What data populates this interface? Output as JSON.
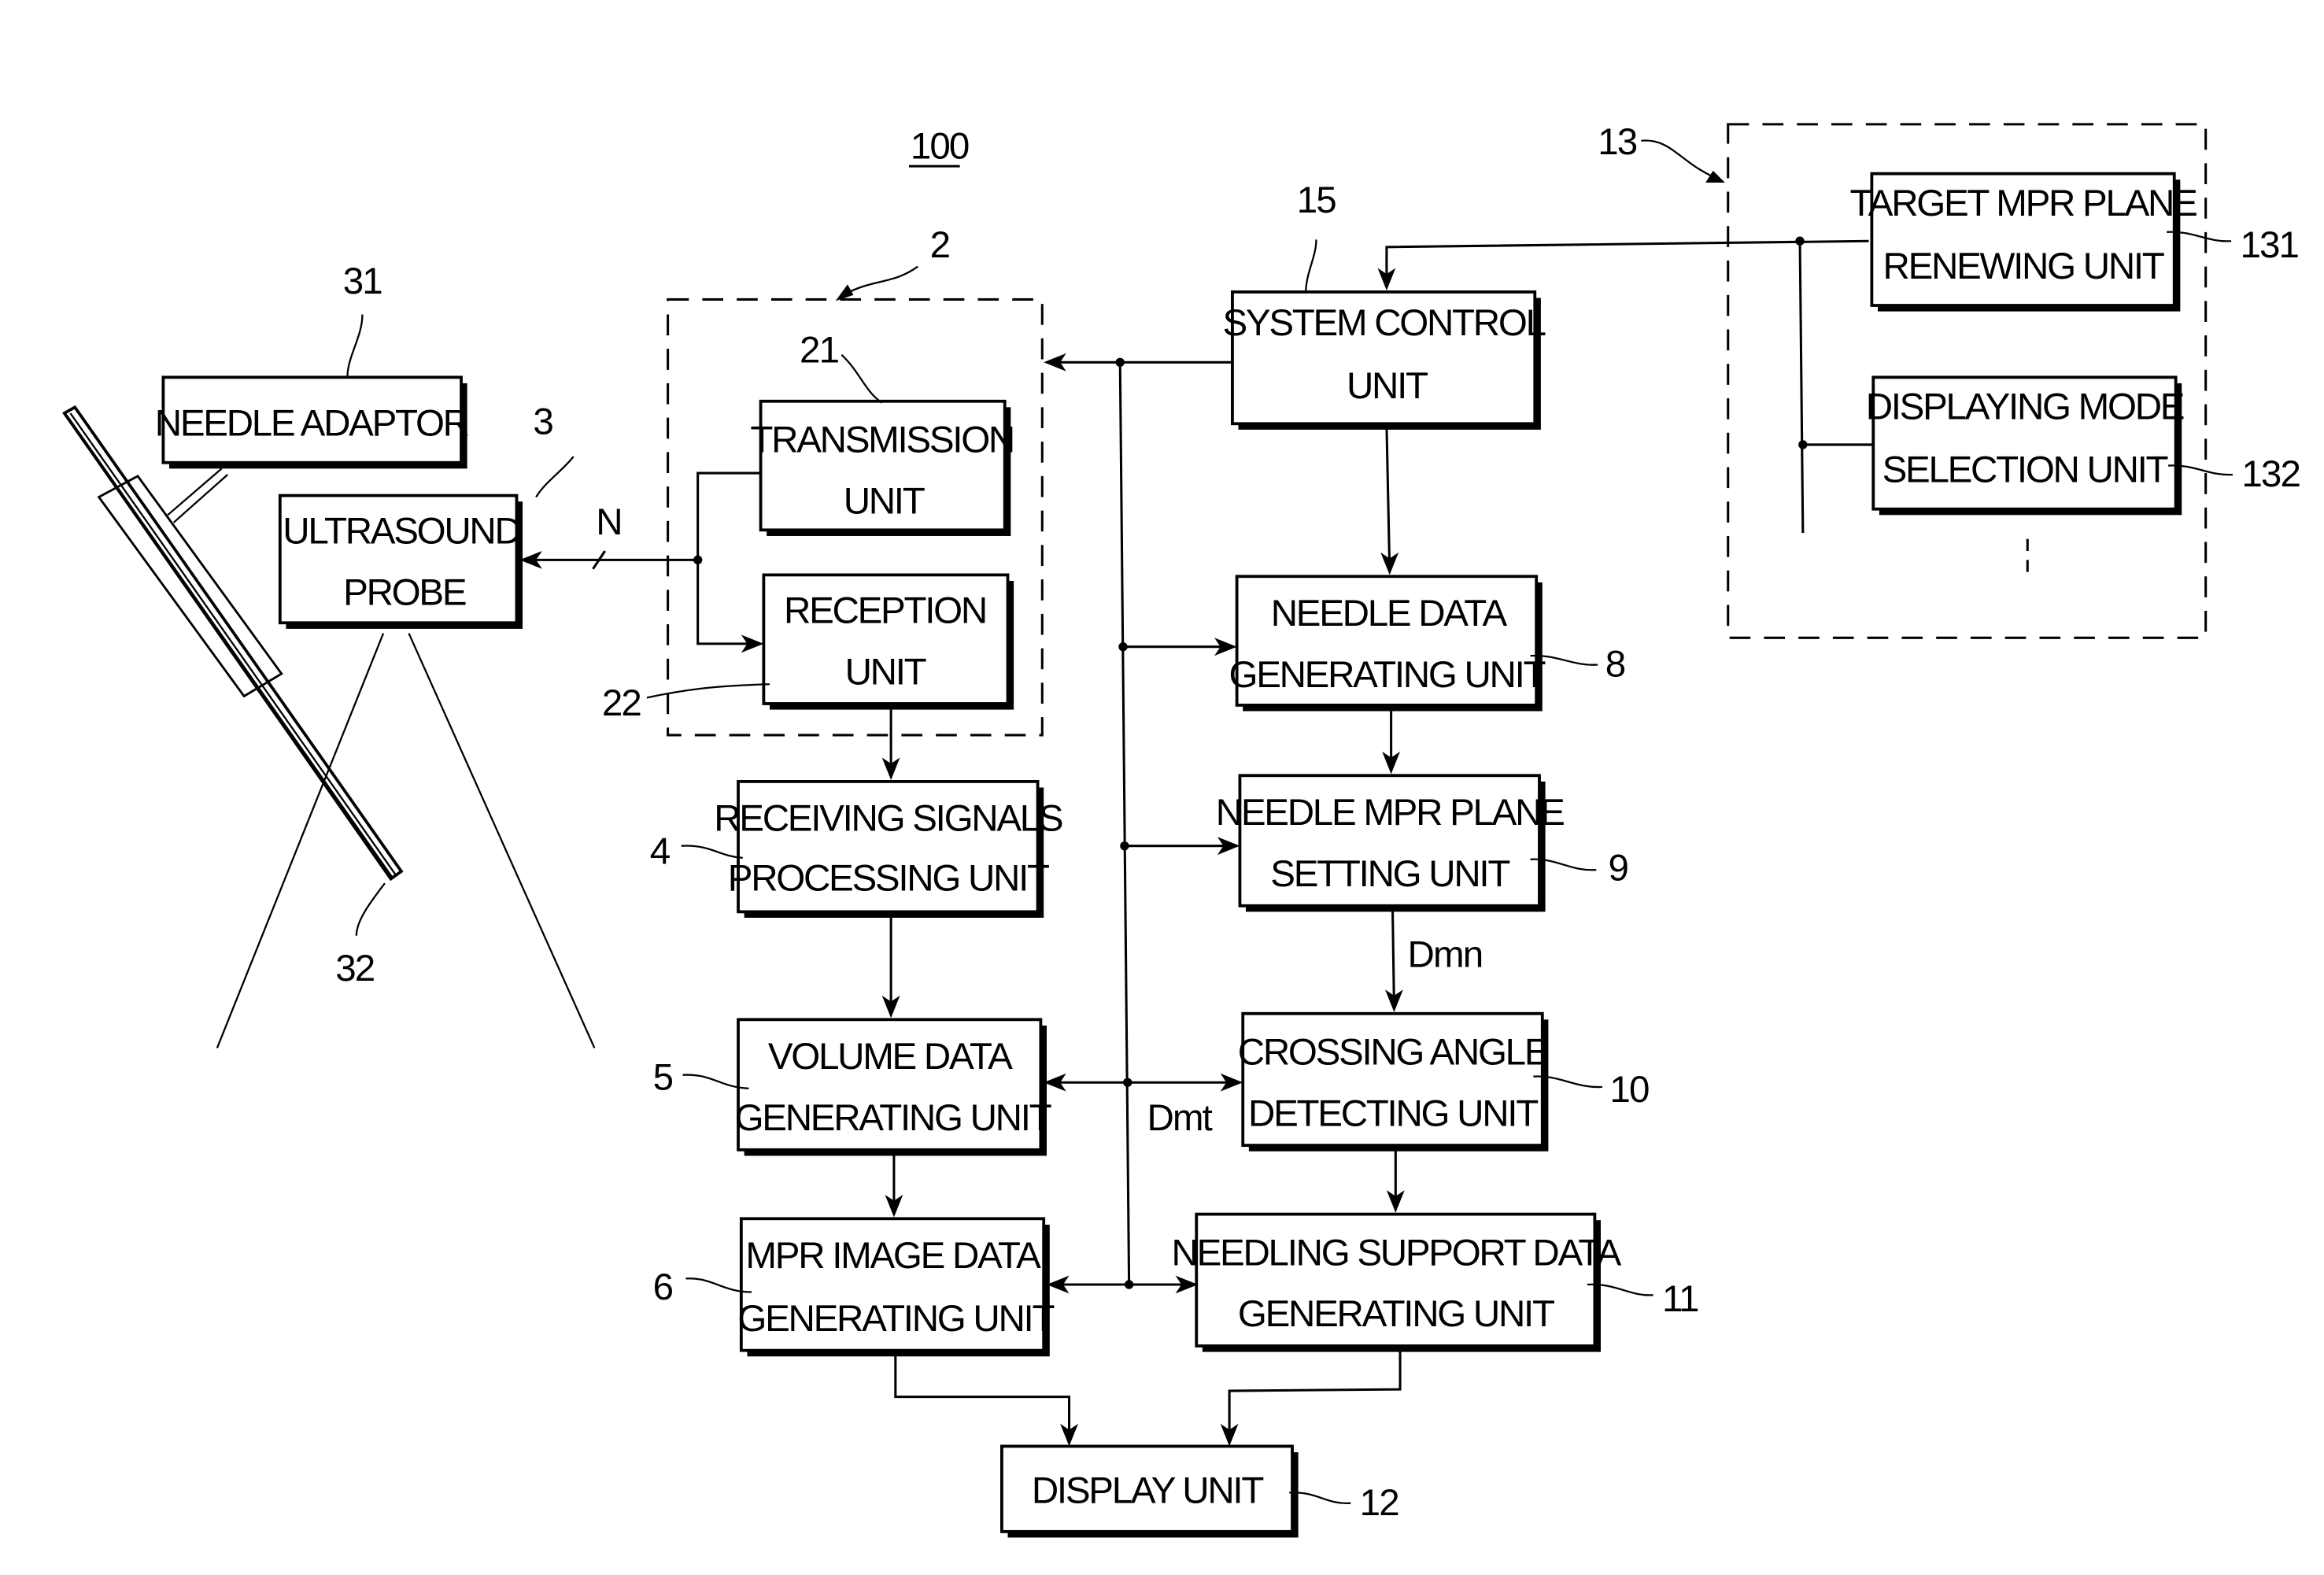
{
  "figure": {
    "reference": "100"
  },
  "blocks": {
    "needle_adaptor": {
      "ref": "31",
      "lines": [
        "NEEDLE ADAPTOR"
      ]
    },
    "ultrasound_probe": {
      "ref": "3",
      "lines": [
        "ULTRASOUND",
        "PROBE"
      ]
    },
    "transmission_unit": {
      "ref": "21",
      "lines": [
        "TRANSMISSION",
        "UNIT"
      ]
    },
    "reception_unit": {
      "ref": "22",
      "lines": [
        "RECEPTION",
        "UNIT"
      ]
    },
    "transceiver_group": {
      "ref": "2"
    },
    "system_control_unit": {
      "ref": "15",
      "lines": [
        "SYSTEM CONTROL",
        "UNIT"
      ]
    },
    "input_group": {
      "ref": "13"
    },
    "target_mpr_plane_renewing_unit": {
      "ref": "131",
      "lines": [
        "TARGET MPR PLANE",
        "RENEWING UNIT"
      ]
    },
    "displaying_mode_selection_unit": {
      "ref": "132",
      "lines": [
        "DISPLAYING MODE",
        "SELECTION UNIT"
      ]
    },
    "receiving_signals_processing_unit": {
      "ref": "4",
      "lines": [
        "RECEIVING SIGNALS",
        "PROCESSING UNIT"
      ]
    },
    "volume_data_generating_unit": {
      "ref": "5",
      "lines": [
        "VOLUME DATA",
        "GENERATING UNIT"
      ]
    },
    "mpr_image_data_generating_unit": {
      "ref": "6",
      "lines": [
        "MPR IMAGE DATA",
        "GENERATING UNIT"
      ]
    },
    "needle_data_generating_unit": {
      "ref": "8",
      "lines": [
        "NEEDLE DATA",
        "GENERATING UNIT"
      ]
    },
    "needle_mpr_plane_setting_unit": {
      "ref": "9",
      "lines": [
        "NEEDLE MPR PLANE",
        "SETTING UNIT"
      ]
    },
    "crossing_angle_detecting_unit": {
      "ref": "10",
      "lines": [
        "CROSSING ANGLE",
        "DETECTING UNIT"
      ]
    },
    "needling_support_data_generating_unit": {
      "ref": "11",
      "lines": [
        "NEEDLING SUPPORT DATA",
        "GENERATING UNIT"
      ]
    },
    "display_unit": {
      "ref": "12",
      "lines": [
        "DISPLAY UNIT"
      ]
    },
    "needle": {
      "ref": "32"
    }
  },
  "signals": {
    "channels": "N",
    "dmn": "Dmn",
    "dmt": "Dmt"
  }
}
